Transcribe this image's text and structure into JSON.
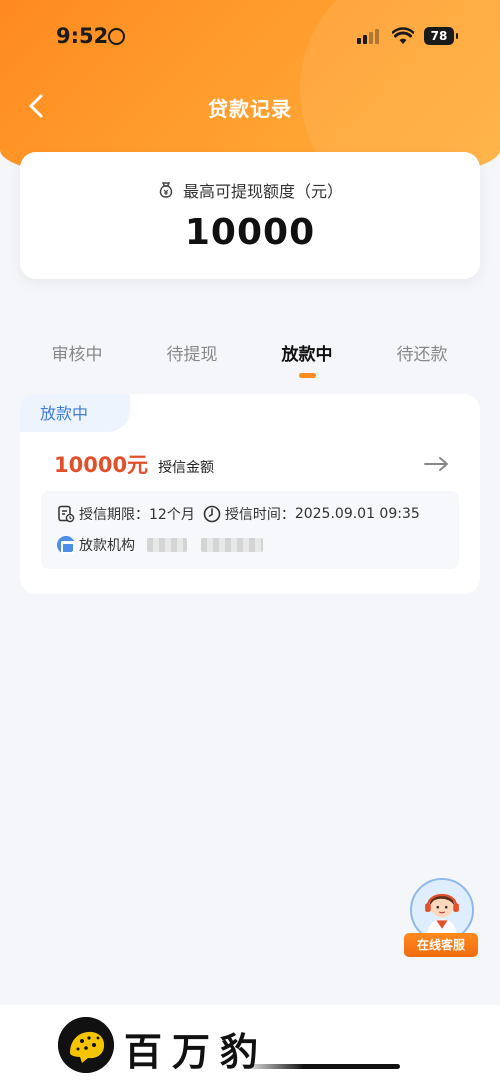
{
  "status_bar": {
    "time": "9:52",
    "battery": "78"
  },
  "header": {
    "title": "贷款记录"
  },
  "limit_card": {
    "label": "最高可提现额度（元）",
    "amount": "10000"
  },
  "tabs": [
    {
      "label": "审核中"
    },
    {
      "label": "待提现"
    },
    {
      "label": "放款中",
      "active": true
    },
    {
      "label": "待还款"
    }
  ],
  "record": {
    "status": "放款中",
    "amount": "10000元",
    "amount_label": "授信金额",
    "term_label": "授信期限：",
    "term_value": "12个月",
    "time_label": "授信时间：",
    "time_value": "2025.09.01  09:35",
    "institution_label": "放款机构"
  },
  "support": {
    "label": "在线客服"
  },
  "brand": {
    "name": "百万豹"
  },
  "colors": {
    "accent": "#ff8a1f",
    "amount_red": "#e2502b",
    "tag_blue": "#3f7fd6"
  }
}
